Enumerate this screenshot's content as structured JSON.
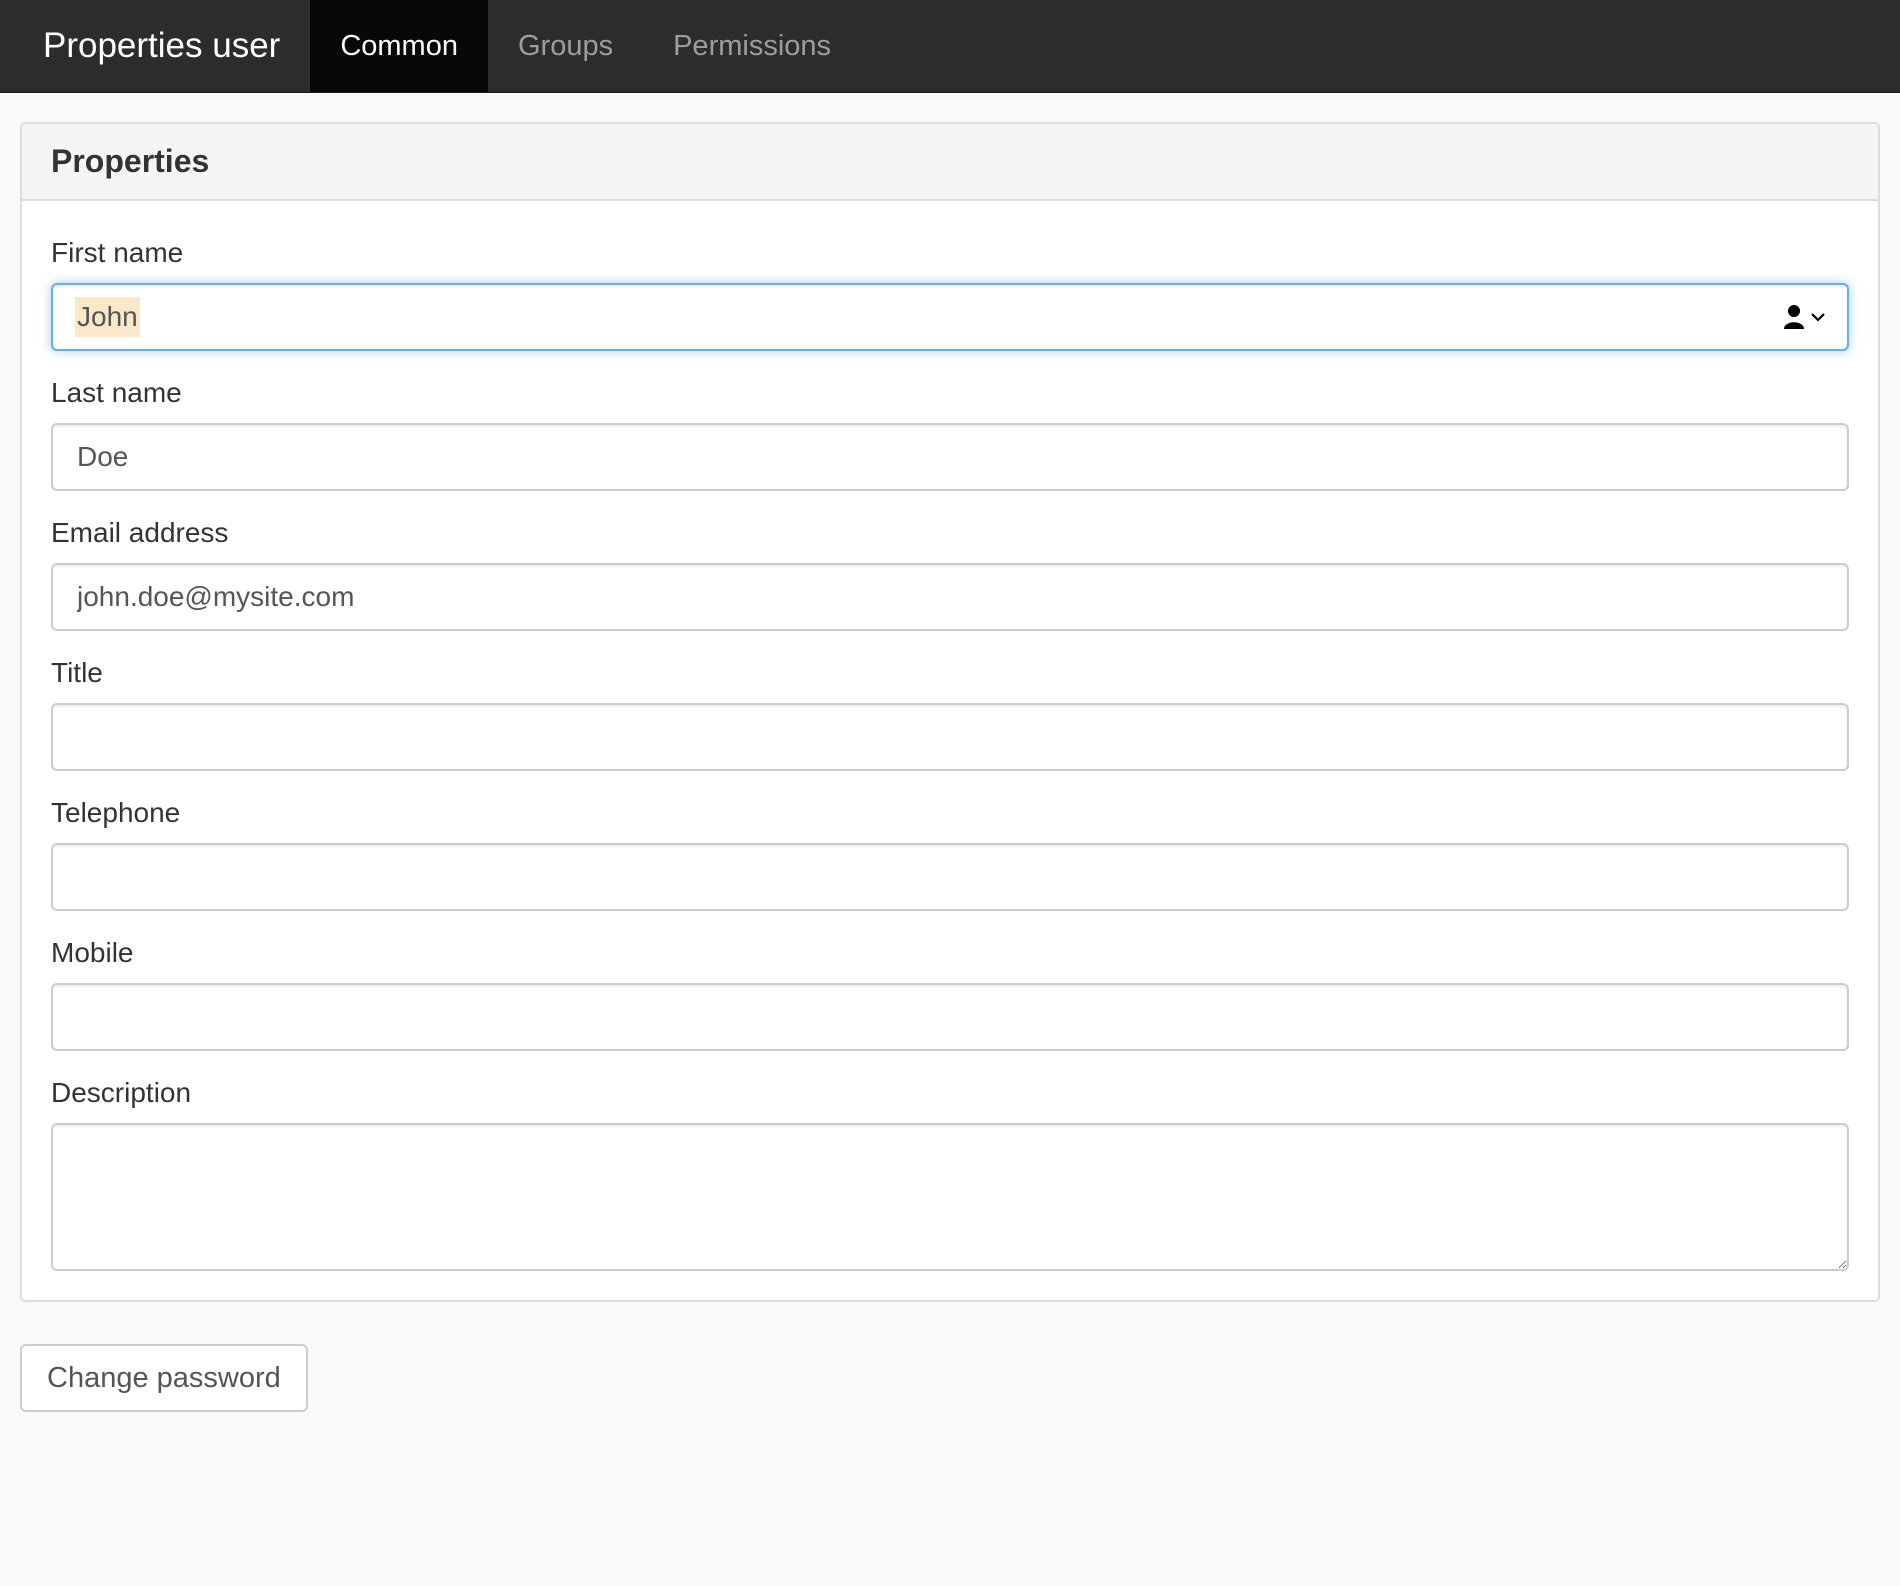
{
  "navbar": {
    "brand": "Properties user",
    "tabs": [
      {
        "label": "Common",
        "active": true
      },
      {
        "label": "Groups",
        "active": false
      },
      {
        "label": "Permissions",
        "active": false
      }
    ]
  },
  "panel": {
    "title": "Properties",
    "fields": {
      "first_name": {
        "label": "First name",
        "value": "John"
      },
      "last_name": {
        "label": "Last name",
        "value": "Doe"
      },
      "email": {
        "label": "Email address",
        "value": "john.doe@mysite.com"
      },
      "title": {
        "label": "Title",
        "value": ""
      },
      "telephone": {
        "label": "Telephone",
        "value": ""
      },
      "mobile": {
        "label": "Mobile",
        "value": ""
      },
      "description": {
        "label": "Description",
        "value": ""
      }
    }
  },
  "actions": {
    "change_password_label": "Change password"
  },
  "colors": {
    "navbar_bg": "#2c2c2c",
    "active_tab_bg": "#080808",
    "focus_border": "#66afe9",
    "autofill_highlight": "#fbe8c8"
  }
}
